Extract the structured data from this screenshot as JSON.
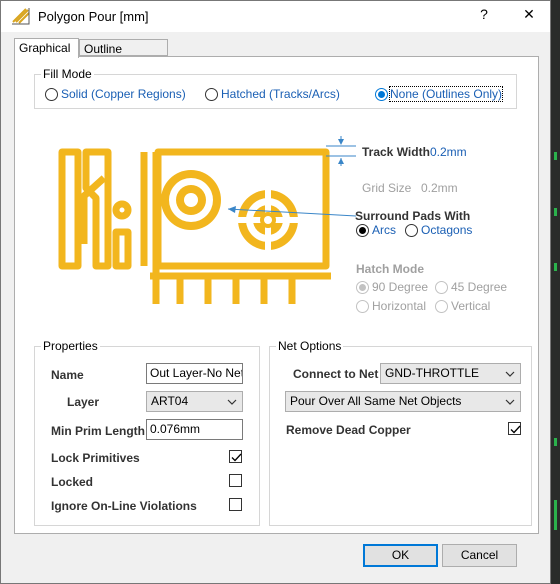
{
  "window": {
    "title": "Polygon Pour [mm]",
    "help_label": "?",
    "close_label": "✕"
  },
  "tabs": [
    {
      "label": "Graphical",
      "active": true
    },
    {
      "label": "Outline Vertices",
      "active": false
    }
  ],
  "fill_mode": {
    "label": "Fill Mode",
    "options": [
      {
        "label": "Solid (Copper Regions)",
        "selected": false
      },
      {
        "label": "Hatched (Tracks/Arcs)",
        "selected": false
      },
      {
        "label": "None (Outlines Only)",
        "selected": true
      }
    ]
  },
  "preview": {
    "track_width_label": "Track Width",
    "track_width_value": "0.2mm",
    "grid_size_label": "Grid Size",
    "grid_size_value": "0.2mm",
    "surround_label": "Surround Pads With",
    "surround_options": [
      {
        "label": "Arcs",
        "selected": true
      },
      {
        "label": "Octagons",
        "selected": false
      }
    ],
    "hatch_mode_label": "Hatch Mode",
    "hatch_options": [
      {
        "label": "90 Degree",
        "selected": true
      },
      {
        "label": "45 Degree",
        "selected": false
      },
      {
        "label": "Horizontal",
        "selected": false
      },
      {
        "label": "Vertical",
        "selected": false
      }
    ],
    "copper_color": "#f2b61e"
  },
  "properties": {
    "label": "Properties",
    "name_label": "Name",
    "name_value": "Out Layer-No Net",
    "layer_label": "Layer",
    "layer_value": "ART04",
    "min_prim_label": "Min Prim Length",
    "min_prim_value": "0.076mm",
    "lock_primitives_label": "Lock Primitives",
    "lock_primitives_checked": true,
    "locked_label": "Locked",
    "locked_checked": false,
    "ignore_label": "Ignore On-Line Violations",
    "ignore_checked": false
  },
  "net_options": {
    "label": "Net Options",
    "connect_label": "Connect to Net",
    "connect_value": "GND-THROTTLE",
    "pour_over_value": "Pour Over All Same Net Objects",
    "remove_dead_label": "Remove Dead Copper",
    "remove_dead_checked": true
  },
  "buttons": {
    "ok": "OK",
    "cancel": "Cancel"
  }
}
